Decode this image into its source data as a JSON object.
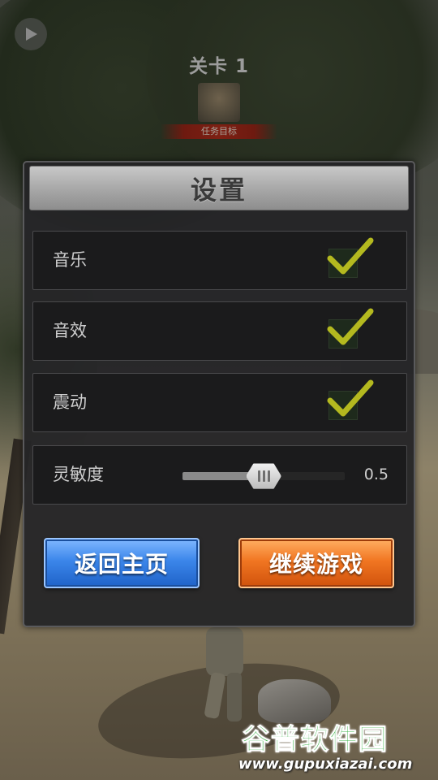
{
  "hud": {
    "level_title": "关卡 1",
    "mission_label": "任务目标",
    "play_icon": "play-icon"
  },
  "settings": {
    "title": "设置",
    "rows": [
      {
        "label": "音乐",
        "checked": true
      },
      {
        "label": "音效",
        "checked": true
      },
      {
        "label": "震动",
        "checked": true
      }
    ],
    "sensitivity": {
      "label": "灵敏度",
      "value": 0.5,
      "value_text": "0.5"
    },
    "buttons": {
      "home_label": "返回主页",
      "continue_label": "继续游戏"
    }
  },
  "watermark": {
    "title": "谷普软件园",
    "url": "www.gupuxiazai.com"
  },
  "colors": {
    "check": "#b4b91f",
    "home_button": "#2f7be0",
    "continue_button": "#ec6c1a",
    "watermark_green": "#3fb44a"
  }
}
